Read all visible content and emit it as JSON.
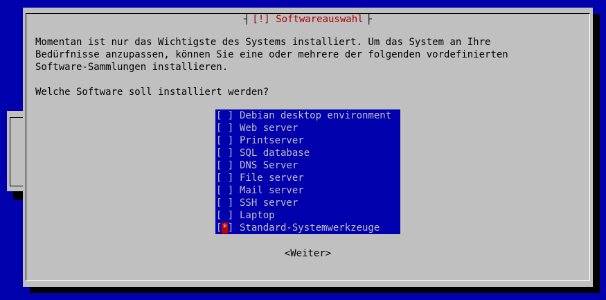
{
  "dialog": {
    "title": "[!] Softwareauswahl",
    "description": "Momentan ist nur das Wichtigste des Systems installiert. Um das System an Ihre\nBedürfnisse anzupassen, können Sie eine oder mehrere der folgenden vordefinierten\nSoftware-Sammlungen installieren.",
    "question": "Welche Software soll installiert werden?",
    "continue_label": "<Weiter>"
  },
  "software": {
    "items": [
      {
        "label": "Debian desktop environment",
        "checkbox": "[ ]"
      },
      {
        "label": "Web server",
        "checkbox": "[ ]"
      },
      {
        "label": "Printserver",
        "checkbox": "[ ]"
      },
      {
        "label": "SQL database",
        "checkbox": "[ ]"
      },
      {
        "label": "DNS Server",
        "checkbox": "[ ]"
      },
      {
        "label": "File server",
        "checkbox": "[ ]"
      },
      {
        "label": "Mail server",
        "checkbox": "[ ]"
      },
      {
        "label": "SSH server",
        "checkbox": "[ ]"
      },
      {
        "label": "Laptop",
        "checkbox": "[ ]"
      },
      {
        "label": "Standard-Systemwerkzeuge",
        "checkbox": "[*]",
        "checked": true
      }
    ]
  },
  "colors": {
    "background": "#0000ad",
    "dialog": "#c0c0c0",
    "title_text": "#a80000",
    "list_background": "#0000ad",
    "list_text": "#c0c0c0",
    "check_mark": "#c00000"
  }
}
